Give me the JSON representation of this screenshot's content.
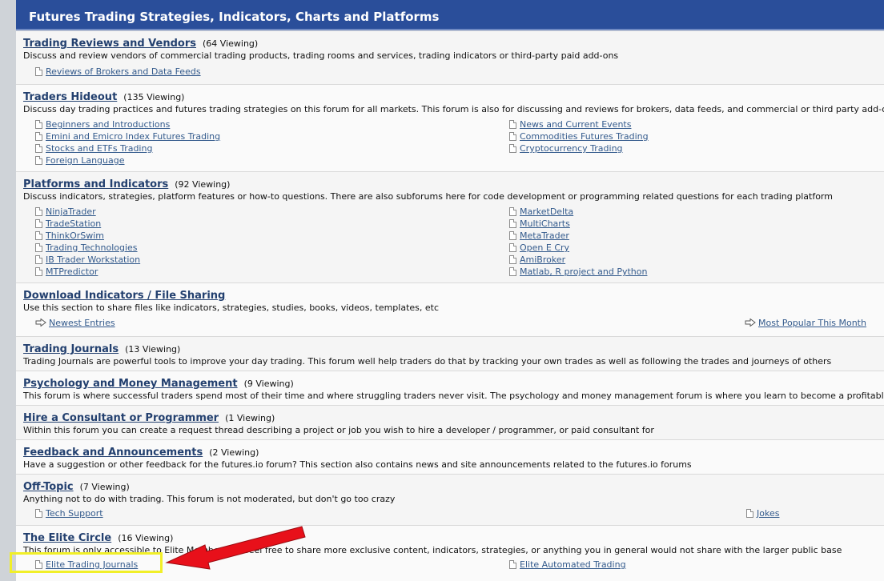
{
  "header": {
    "title": "Futures Trading Strategies, Indicators, Charts and Platforms"
  },
  "forums": [
    {
      "title": "Trading Reviews and Vendors",
      "viewing": "(64 Viewing)",
      "desc": "Discuss and review vendors of commercial trading products, trading rooms and services, trading indicators or third-party paid add-ons",
      "subs_left": [
        "Reviews of Brokers and Data Feeds"
      ],
      "subs_right": []
    },
    {
      "title": "Traders Hideout",
      "viewing": "(135 Viewing)",
      "desc": "Discuss day trading practices and futures trading strategies on this forum for all markets. This forum is also for discussing and reviews for brokers, data feeds, and commercial or third party add-ons",
      "subs_left": [
        "Beginners and Introductions",
        "Emini and Emicro Index Futures Trading",
        "Stocks and ETFs Trading",
        "Foreign Language"
      ],
      "subs_right": [
        "News and Current Events",
        "Commodities Futures Trading",
        "Cryptocurrency Trading"
      ]
    },
    {
      "title": "Platforms and Indicators",
      "viewing": "(92 Viewing)",
      "desc": "Discuss indicators, strategies, platform features or how-to questions. There are also subforums here for code development or programming related questions for each trading platform",
      "subs_left": [
        "NinjaTrader",
        "TradeStation",
        "ThinkOrSwim",
        "Trading Technologies",
        "IB Trader Workstation",
        "MTPredictor"
      ],
      "subs_right": [
        "MarketDelta",
        "MultiCharts",
        "MetaTrader",
        "Open E Cry",
        "AmiBroker",
        "Matlab, R project and Python"
      ]
    },
    {
      "title": "Download Indicators / File Sharing",
      "viewing": "",
      "desc": "Use this section to share files like indicators, strategies, studies, books, videos, templates, etc",
      "links_left": [
        "Newest Entries"
      ],
      "links_right": [
        "Most Popular This Month"
      ]
    },
    {
      "title": "Trading Journals",
      "viewing": "(13 Viewing)",
      "desc": "Trading Journals are powerful tools to improve your day trading. This forum well help traders do that by tracking your own trades as well as following the trades and journeys of others"
    },
    {
      "title": "Psychology and Money Management",
      "viewing": "(9 Viewing)",
      "desc": "This forum is where successful traders spend most of their time and where struggling traders never visit. The psychology and money management forum is where you learn to become a profitable trader"
    },
    {
      "title": "Hire a Consultant or Programmer",
      "viewing": "(1 Viewing)",
      "desc": "Within this forum you can create a request thread describing a project or job you wish to hire a developer / programmer, or paid consultant for"
    },
    {
      "title": "Feedback and Announcements",
      "viewing": "(2 Viewing)",
      "desc": "Have a suggestion or other feedback for the futures.io forum? This section also contains news and site announcements related to the futures.io forums"
    },
    {
      "title": "Off-Topic",
      "viewing": "(7 Viewing)",
      "desc": "Anything not to do with trading. This forum is not moderated, but don't go too crazy",
      "subs_left": [
        "Tech Support"
      ],
      "subs_right": [
        "Jokes"
      ]
    },
    {
      "title": "The Elite Circle",
      "viewing": "(16 Viewing)",
      "desc": "This forum is only accessible to Elite Members, so feel free to share more exclusive content, indicators, strategies, or anything you in general would not share with the larger public base",
      "subs_left": [
        "Elite Trading Journals"
      ],
      "subs_right": [
        "Elite Automated Trading"
      ]
    }
  ],
  "colors": {
    "header_bg": "#2a4e9a",
    "link": "#23406f",
    "highlight": "#f1ef28",
    "arrow": "#e8101a"
  }
}
